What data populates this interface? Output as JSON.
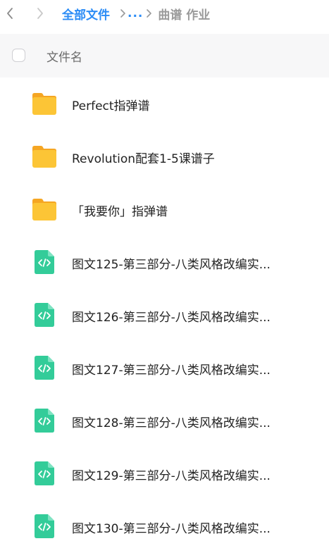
{
  "breadcrumb": {
    "root": "全部文件",
    "ellipsis": "...",
    "current": "曲谱 作业"
  },
  "header": {
    "column_label": "文件名"
  },
  "colors": {
    "accent": "#2b8cf6",
    "folder": "#fbc02d",
    "code_file": "#2ccf9a"
  },
  "files": [
    {
      "name": "Perfect指弹谱",
      "type": "folder",
      "icon": "folder-icon"
    },
    {
      "name": "Revolution配套1-5课谱子",
      "type": "folder",
      "icon": "folder-icon"
    },
    {
      "name": "「我要你」指弹谱",
      "type": "folder",
      "icon": "folder-icon"
    },
    {
      "name": "图文125-第三部分-八类风格改编实...",
      "type": "code",
      "icon": "code-file-icon"
    },
    {
      "name": "图文126-第三部分-八类风格改编实...",
      "type": "code",
      "icon": "code-file-icon"
    },
    {
      "name": "图文127-第三部分-八类风格改编实...",
      "type": "code",
      "icon": "code-file-icon"
    },
    {
      "name": "图文128-第三部分-八类风格改编实...",
      "type": "code",
      "icon": "code-file-icon"
    },
    {
      "name": "图文129-第三部分-八类风格改编实...",
      "type": "code",
      "icon": "code-file-icon"
    },
    {
      "name": "图文130-第三部分-八类风格改编实...",
      "type": "code",
      "icon": "code-file-icon"
    }
  ]
}
